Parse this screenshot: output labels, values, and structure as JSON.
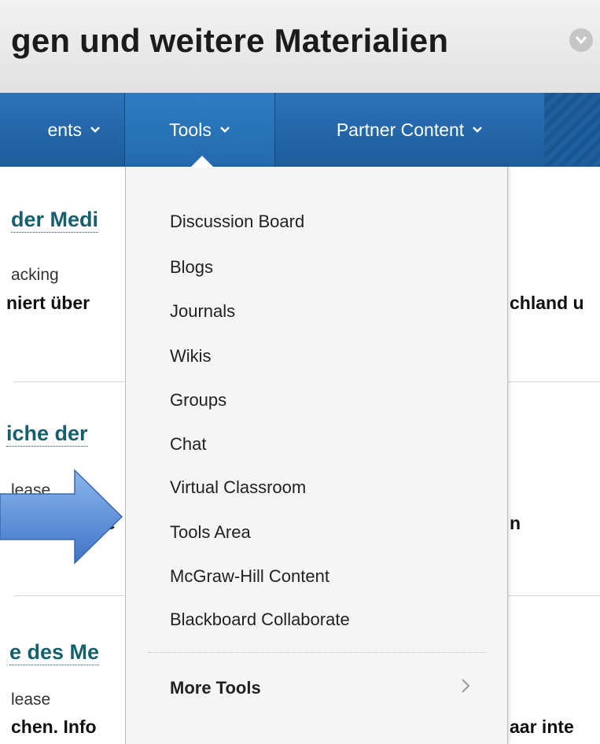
{
  "header": {
    "title": "gen und weitere Materialien"
  },
  "tabs": [
    {
      "label": "ents"
    },
    {
      "label": "Tools"
    },
    {
      "label": "Partner Content"
    }
  ],
  "content": {
    "sections": [
      {
        "heading": "der Medi",
        "meta": "acking",
        "desc_left": "niert über",
        "desc_right": "chland u"
      },
      {
        "heading": "iche der",
        "meta": "lease",
        "desc_left": "e",
        "desc_right": "n"
      },
      {
        "heading": "e des Me",
        "meta": "lease",
        "desc_left": "chen. Info",
        "desc_right": "aar inte"
      }
    ]
  },
  "menu": {
    "items": [
      {
        "label": "Discussion Board"
      },
      {
        "label": "Blogs"
      },
      {
        "label": "Journals"
      },
      {
        "label": "Wikis"
      },
      {
        "label": "Groups"
      },
      {
        "label": "Chat"
      },
      {
        "label": "Virtual Classroom"
      },
      {
        "label": "Tools Area"
      },
      {
        "label": "McGraw-Hill Content"
      },
      {
        "label": "Blackboard Collaborate"
      }
    ],
    "more": {
      "label": "More Tools",
      "icon": "chevron-right-icon"
    }
  },
  "colors": {
    "tabbar": "#2b73b8",
    "heading": "#16606e",
    "arrow": "#5b8fd8"
  }
}
